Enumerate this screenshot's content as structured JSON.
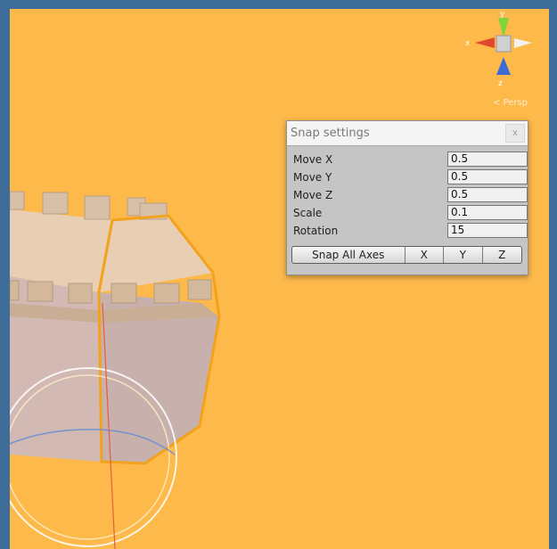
{
  "gizmo": {
    "axis_y": "y",
    "axis_x": "x",
    "axis_z": "z",
    "projection": "< Persp"
  },
  "snap_settings": {
    "title": "Snap settings",
    "close_label": "x",
    "rows": [
      {
        "label": "Move X",
        "value": "0.5"
      },
      {
        "label": "Move Y",
        "value": "0.5"
      },
      {
        "label": "Move Z",
        "value": "0.5"
      },
      {
        "label": "Scale",
        "value": "0.1"
      },
      {
        "label": "Rotation",
        "value": "15"
      }
    ],
    "buttons": {
      "snap_all": "Snap All Axes",
      "x": "X",
      "y": "Y",
      "z": "Z"
    }
  },
  "colors": {
    "viewport_background": "#fdb94a",
    "outer_background": "#3f6d99",
    "selection_outline": "#f3a21b",
    "tower_color": "#d9c0b8"
  }
}
